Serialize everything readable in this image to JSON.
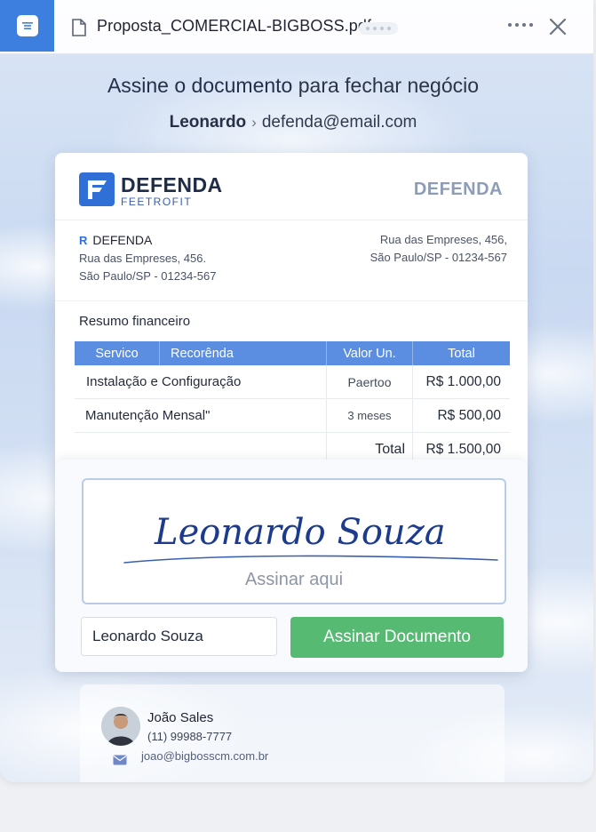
{
  "titlebar": {
    "filename": "Proposta_COMERCIAL-BIGBOSS.pdf",
    "icons": {
      "app": "document-lines-icon",
      "file": "file-icon",
      "more": "more-horizontal-icon",
      "close": "close-icon"
    }
  },
  "header": {
    "title_bold": "Assine o documento",
    "title_rest": " para fechar negócio",
    "signer_name": "Leonardo",
    "signer_separator": "›",
    "signer_email": "defenda@email.com"
  },
  "document": {
    "logo_word": "DEFENDA",
    "logo_sub": "FEETROFIT",
    "brand_right": "DEFENDA",
    "company": {
      "icon": "R",
      "name": "DEFENDA",
      "street": "Rua das Empreses, 456.",
      "city": "São Paulo/SP - 01234-567"
    },
    "company_right": {
      "street": "Rua das Empreses, 456,",
      "city": "São Paulo/SP - 01234-567"
    },
    "summary_title": "Resumo financeiro",
    "table": {
      "headers": [
        "Servico",
        "Recorênda",
        "Valor Un.",
        "Total"
      ],
      "rows": [
        {
          "service": "Instalação e Configuração",
          "qty": "Paertoo",
          "total": "R$ 1.000,00"
        },
        {
          "service": "Manutenção Mensal\"",
          "qty": "3 meses",
          "total": "R$ 500,00"
        }
      ],
      "total_label": "Total",
      "total_value": "R$ 1.500,00"
    }
  },
  "signature": {
    "signature_text": "Leonardo Souza",
    "hint": "Assinar aqui",
    "name_value": "Leonardo Souza",
    "button_label": "Assinar Documento",
    "colors": {
      "button": "#56ba73",
      "ink": "#1d3b8c"
    }
  },
  "contact": {
    "name": "João Sales",
    "phone": "(11) 99988-7777",
    "email": "joao@bigbosscm.com.br",
    "icons": {
      "avatar": "avatar",
      "mail": "mail-icon"
    }
  }
}
